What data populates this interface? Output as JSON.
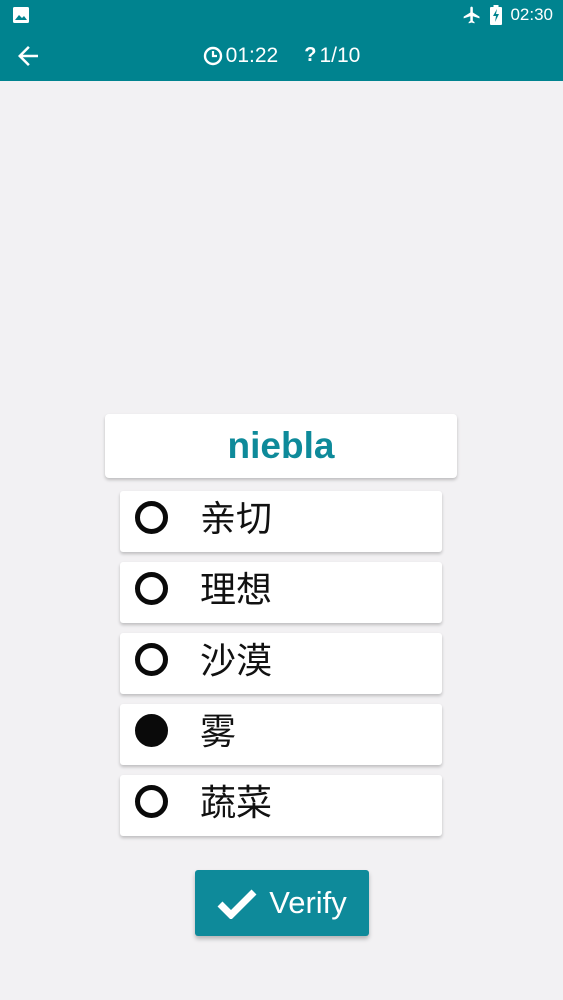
{
  "status_bar": {
    "time": "02:30",
    "icons": [
      "gallery-icon",
      "airplane-mode-icon",
      "battery-charging-icon"
    ]
  },
  "app_bar": {
    "timer": "01:22",
    "timer_icon": "clock-icon",
    "progress": "1/10",
    "progress_icon": "question-mark-icon",
    "back_icon": "arrow-left-icon"
  },
  "quiz": {
    "word": "niebla",
    "options": [
      {
        "label": "亲切",
        "selected": false
      },
      {
        "label": "理想",
        "selected": false
      },
      {
        "label": "沙漠",
        "selected": false
      },
      {
        "label": "雾",
        "selected": true
      },
      {
        "label": "蔬菜",
        "selected": false
      }
    ]
  },
  "verify": {
    "label": "Verify",
    "icon": "checkmark-icon"
  },
  "colors": {
    "primary": "#00838f",
    "accent": "#0e8a9a",
    "background": "#f2f1f3"
  }
}
